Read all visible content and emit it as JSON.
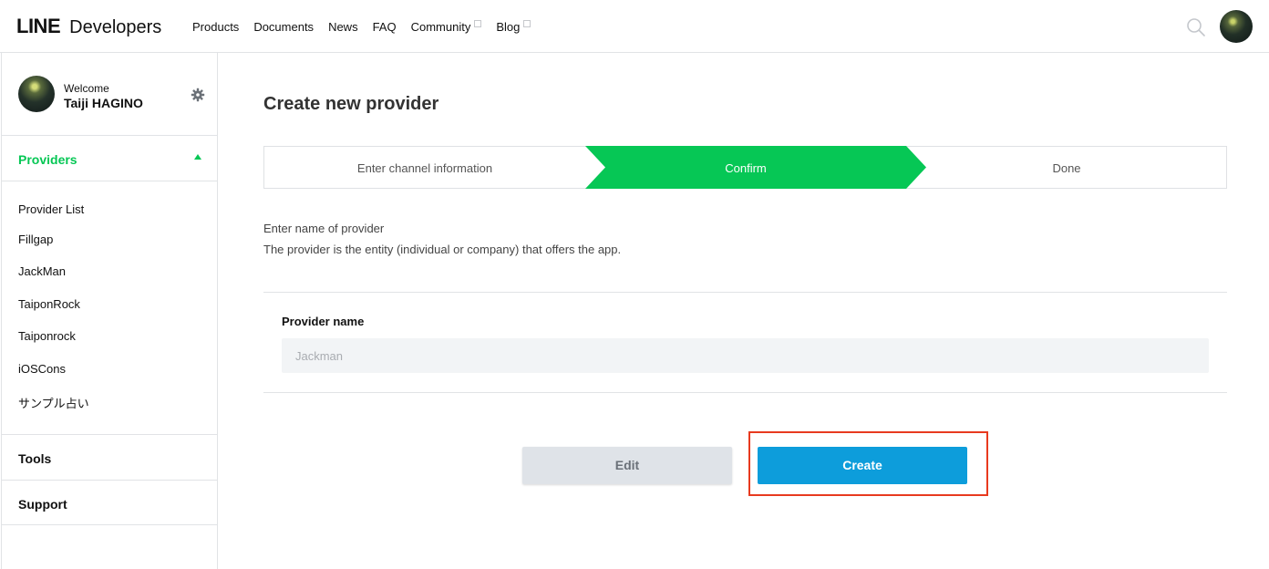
{
  "header": {
    "logo_line": "LINE",
    "logo_dev": "Developers",
    "nav": [
      {
        "label": "Products",
        "external": false
      },
      {
        "label": "Documents",
        "external": false
      },
      {
        "label": "News",
        "external": false
      },
      {
        "label": "FAQ",
        "external": false
      },
      {
        "label": "Community",
        "external": true
      },
      {
        "label": "Blog",
        "external": true
      }
    ]
  },
  "sidebar": {
    "welcome": "Welcome",
    "username": "Taiji HAGINO",
    "providers_label": "Providers",
    "provider_list": [
      "Provider List",
      "Fillgap",
      "JackMan",
      "TaiponRock",
      "Taiponrock",
      "iOSCons",
      "サンプル占い"
    ],
    "tools_label": "Tools",
    "support_label": "Support"
  },
  "main": {
    "title": "Create new provider",
    "steps": [
      {
        "label": "Enter channel information",
        "active": false
      },
      {
        "label": "Confirm",
        "active": true
      },
      {
        "label": "Done",
        "active": false
      }
    ],
    "desc_line1": "Enter name of provider",
    "desc_line2": "The provider is the entity (individual or company) that offers the app.",
    "field_label": "Provider name",
    "field_value": "Jackman",
    "edit_label": "Edit",
    "create_label": "Create"
  },
  "colors": {
    "accent_green": "#06c755",
    "primary_blue": "#0d9ddb",
    "highlight_red": "#e83a1f"
  },
  "icons": [
    "search-icon",
    "gear-icon",
    "caret-up-icon",
    "external-link-icon"
  ]
}
